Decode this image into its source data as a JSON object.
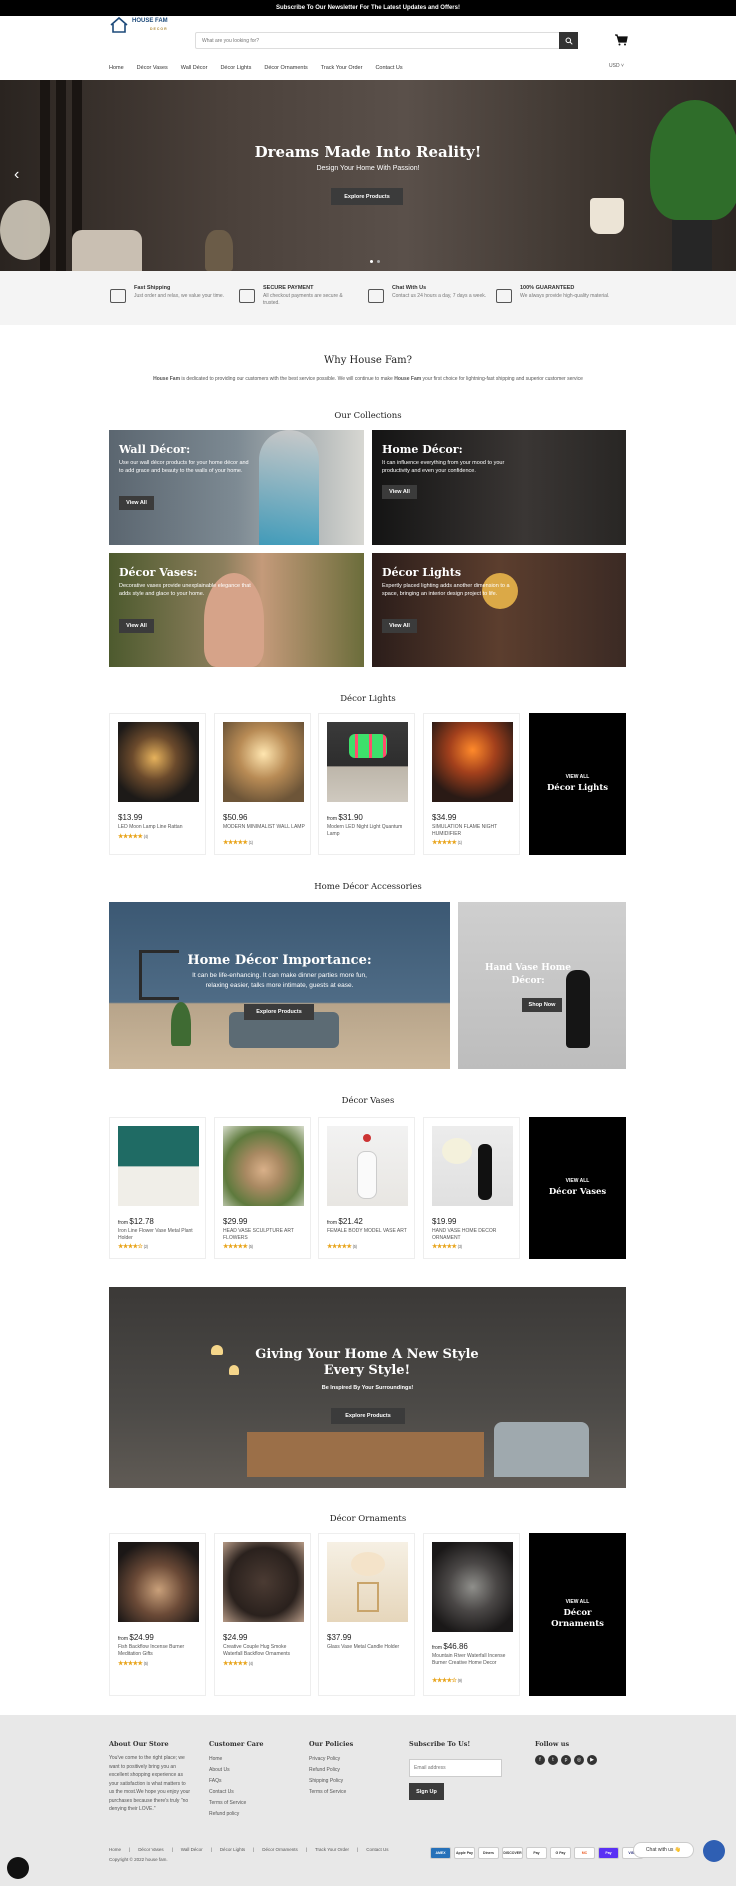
{
  "topbar": {
    "text": "Subscribe To Our Newsletter For The Latest Updates and Offers!"
  },
  "header": {
    "logo_line1": "HOUSE FAM",
    "logo_line2": "DECOR",
    "search_placeholder": "What are you looking for?",
    "currency": "USD ˅"
  },
  "nav": [
    "Home",
    "Décor Vases",
    "Wall Décor",
    "Décor Lights",
    "Décor Ornaments",
    "Track Your Order",
    "Contact Us"
  ],
  "hero": {
    "title": "Dreams Made Into Reality!",
    "subtitle": "Design Your Home With Passion!",
    "button": "Explore Products"
  },
  "features": [
    {
      "title": "Fast Shipping",
      "desc": "Just order and relax, we value your time."
    },
    {
      "title": "SECURE PAYMENT",
      "desc": "All checkout payments are secure & trusted."
    },
    {
      "title": "Chat With Us",
      "desc": "Contact us 24 hours a day, 7 days a week."
    },
    {
      "title": "100% GUARANTEED",
      "desc": "We always provide high-quality material."
    }
  ],
  "why": {
    "title": "Why House Fam?",
    "brand": "House Fam",
    "text1": " is dedicated to providing our customers with the best service possible. We will continue to make ",
    "text2": " your first choice for lightning-fast shipping and superior customer service"
  },
  "collections": {
    "title": "Our Collections",
    "items": [
      {
        "title": "Wall Décor:",
        "desc": "Use our wall décor products for your home décor and to add grace and beauty to the walls of your home.",
        "button": "View All"
      },
      {
        "title": "Home Décor:",
        "desc": "It can influence everything from your mood to your productivity and even your confidence.",
        "button": "View All"
      },
      {
        "title": "Décor Vases:",
        "desc": "Decorative vases provide unexplainable elegance that adds style and glace to your home.",
        "button": "View All"
      },
      {
        "title": "Décor Lights",
        "desc": "Expertly placed lighting adds another dimension to a space, bringing an interior design project to life.",
        "button": "View All"
      }
    ]
  },
  "lights": {
    "title": "Décor Lights",
    "products": [
      {
        "price": "$13.99",
        "from": "",
        "name": "LED Moon Lamp Line Rattan",
        "stars": "★★★★★",
        "reviews": "(4)"
      },
      {
        "price": "$50.96",
        "from": "",
        "name": "MODERN MINIMALIST WALL LAMP",
        "stars": "★★★★★",
        "reviews": "(1)"
      },
      {
        "price": "$31.90",
        "from": "from ",
        "name": "Modern LED Night Light Quantum Lamp",
        "stars": "",
        "reviews": ""
      },
      {
        "price": "$34.99",
        "from": "",
        "name": "SIMULATION FLAME NIGHT HUMIDIFIER",
        "stars": "★★★★★",
        "reviews": "(1)"
      }
    ],
    "viewall_label": "VIEW ALL",
    "viewall_title": "Décor Lights"
  },
  "accessories": {
    "title": "Home Décor Accessories",
    "banner1_title": "Home Décor Importance:",
    "banner1_desc": "It can be life-enhancing. It can make dinner parties more fun, relaxing easier, talks more intimate, guests at ease.",
    "banner1_button": "Explore Products",
    "banner2_title": "Hand Vase Home Décor:",
    "banner2_button": "Shop Now"
  },
  "vases": {
    "title": "Décor Vases",
    "products": [
      {
        "price": "$12.78",
        "from": "from ",
        "name": "Iron Line Flower Vase Metal Plant Holder",
        "stars": "★★★★☆",
        "reviews": "(2)"
      },
      {
        "price": "$29.99",
        "from": "",
        "name": "HEAD VASE SCULPTURE ART FLOWERS",
        "stars": "★★★★★",
        "reviews": "(5)"
      },
      {
        "price": "$21.42",
        "from": "from ",
        "name": "FEMALE BODY MODEL VASE ART",
        "stars": "★★★★★",
        "reviews": "(5)"
      },
      {
        "price": "$19.99",
        "from": "",
        "name": "HAND VASE HOME DECOR ORNAMENT",
        "stars": "★★★★★",
        "reviews": "(3)"
      }
    ],
    "viewall_label": "VIEW ALL",
    "viewall_title": "Décor Vases"
  },
  "style_banner": {
    "title": "Giving Your Home A New Style Every Style!",
    "subtitle": "Be Inspired By Your Surroundings!",
    "button": "Explore Products"
  },
  "ornaments": {
    "title": "Décor Ornaments",
    "products": [
      {
        "price": "$24.99",
        "from": "from ",
        "name": "Fish Backflow Incense Burner Meditation Gifts",
        "stars": "★★★★★",
        "reviews": "(5)"
      },
      {
        "price": "$24.99",
        "from": "",
        "name": "Creative Couple Hug Smoke Waterfall Backflow Ornaments",
        "stars": "★★★★★",
        "reviews": "(4)"
      },
      {
        "price": "$37.99",
        "from": "",
        "name": "Glass Vase Metal Candle Holder",
        "stars": "",
        "reviews": ""
      },
      {
        "price": "$46.86",
        "from": "from ",
        "name": "Mountain River Waterfall Incense Burner Creative Home Decor",
        "stars": "★★★★☆",
        "reviews": "(9)"
      }
    ],
    "viewall_label": "VIEW ALL",
    "viewall_title": "Décor Ornaments"
  },
  "footer": {
    "about_title": "About Our Store",
    "about_text": "You've come to the right place; we want to positively bring you an excellent shopping experience as your satisfaction is what matters to us the most.We hope you enjoy your purchases because there's truly \"no denying their LOVE.\"",
    "care_title": "Customer Care",
    "care_links": [
      "Home",
      "About Us",
      "FAQs",
      "Contact Us",
      "Terms of Service",
      "Refund policy"
    ],
    "policies_title": "Our Policies",
    "policies_links": [
      "Privacy Policy",
      "Refund Policy",
      "Shipping Policy",
      "Terms of Service"
    ],
    "subscribe_title": "Subscribe To Us!",
    "email_placeholder": "Email address",
    "signup": "Sign Up",
    "follow_title": "Follow us",
    "bottom_nav": [
      "Home",
      "Décor Vases",
      "Wall Décor",
      "Décor Lights",
      "Décor Ornaments",
      "Track Your Order",
      "Contact Us"
    ],
    "copyright": "Copyright © 2022 house fam.",
    "payments": [
      "AMEX",
      "Apple Pay",
      "Diners",
      "DISCOVER",
      "Pay",
      "G Pay",
      "MC",
      "Pay",
      "VISA"
    ],
    "chat_label": "Chat with us 👋"
  }
}
